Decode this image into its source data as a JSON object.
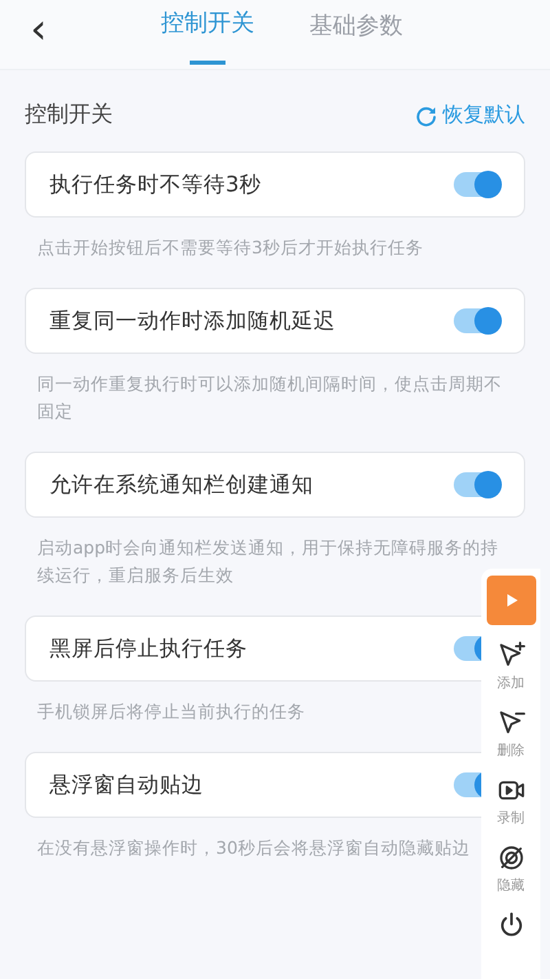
{
  "header": {
    "back": "‹",
    "tabs": [
      {
        "label": "控制开关",
        "selected": true
      },
      {
        "label": "基础参数",
        "selected": false
      }
    ]
  },
  "section": {
    "title": "控制开关",
    "restore": "恢复默认"
  },
  "settings": [
    {
      "label": "执行任务时不等待3秒",
      "on": true,
      "description": "点击开始按钮后不需要等待3秒后才开始执行任务"
    },
    {
      "label": "重复同一动作时添加随机延迟",
      "on": true,
      "description": "同一动作重复执行时可以添加随机间隔时间，使点击周期不固定"
    },
    {
      "label": "允许在系统通知栏创建通知",
      "on": true,
      "description": "启动app时会向通知栏发送通知，用于保持无障碍服务的持续运行，重启服务后生效"
    },
    {
      "label": "黑屏后停止执行任务",
      "on": true,
      "description": "手机锁屏后将停止当前执行的任务"
    },
    {
      "label": "悬浮窗自动贴边",
      "on": true,
      "description": "在没有悬浮窗操作时，30秒后会将悬浮窗自动隐藏贴边"
    }
  ],
  "float_panel": [
    {
      "kind": "play"
    },
    {
      "kind": "add",
      "label": "添加"
    },
    {
      "kind": "delete",
      "label": "删除"
    },
    {
      "kind": "record",
      "label": "录制"
    },
    {
      "kind": "hide",
      "label": "隐藏"
    },
    {
      "kind": "power"
    }
  ]
}
